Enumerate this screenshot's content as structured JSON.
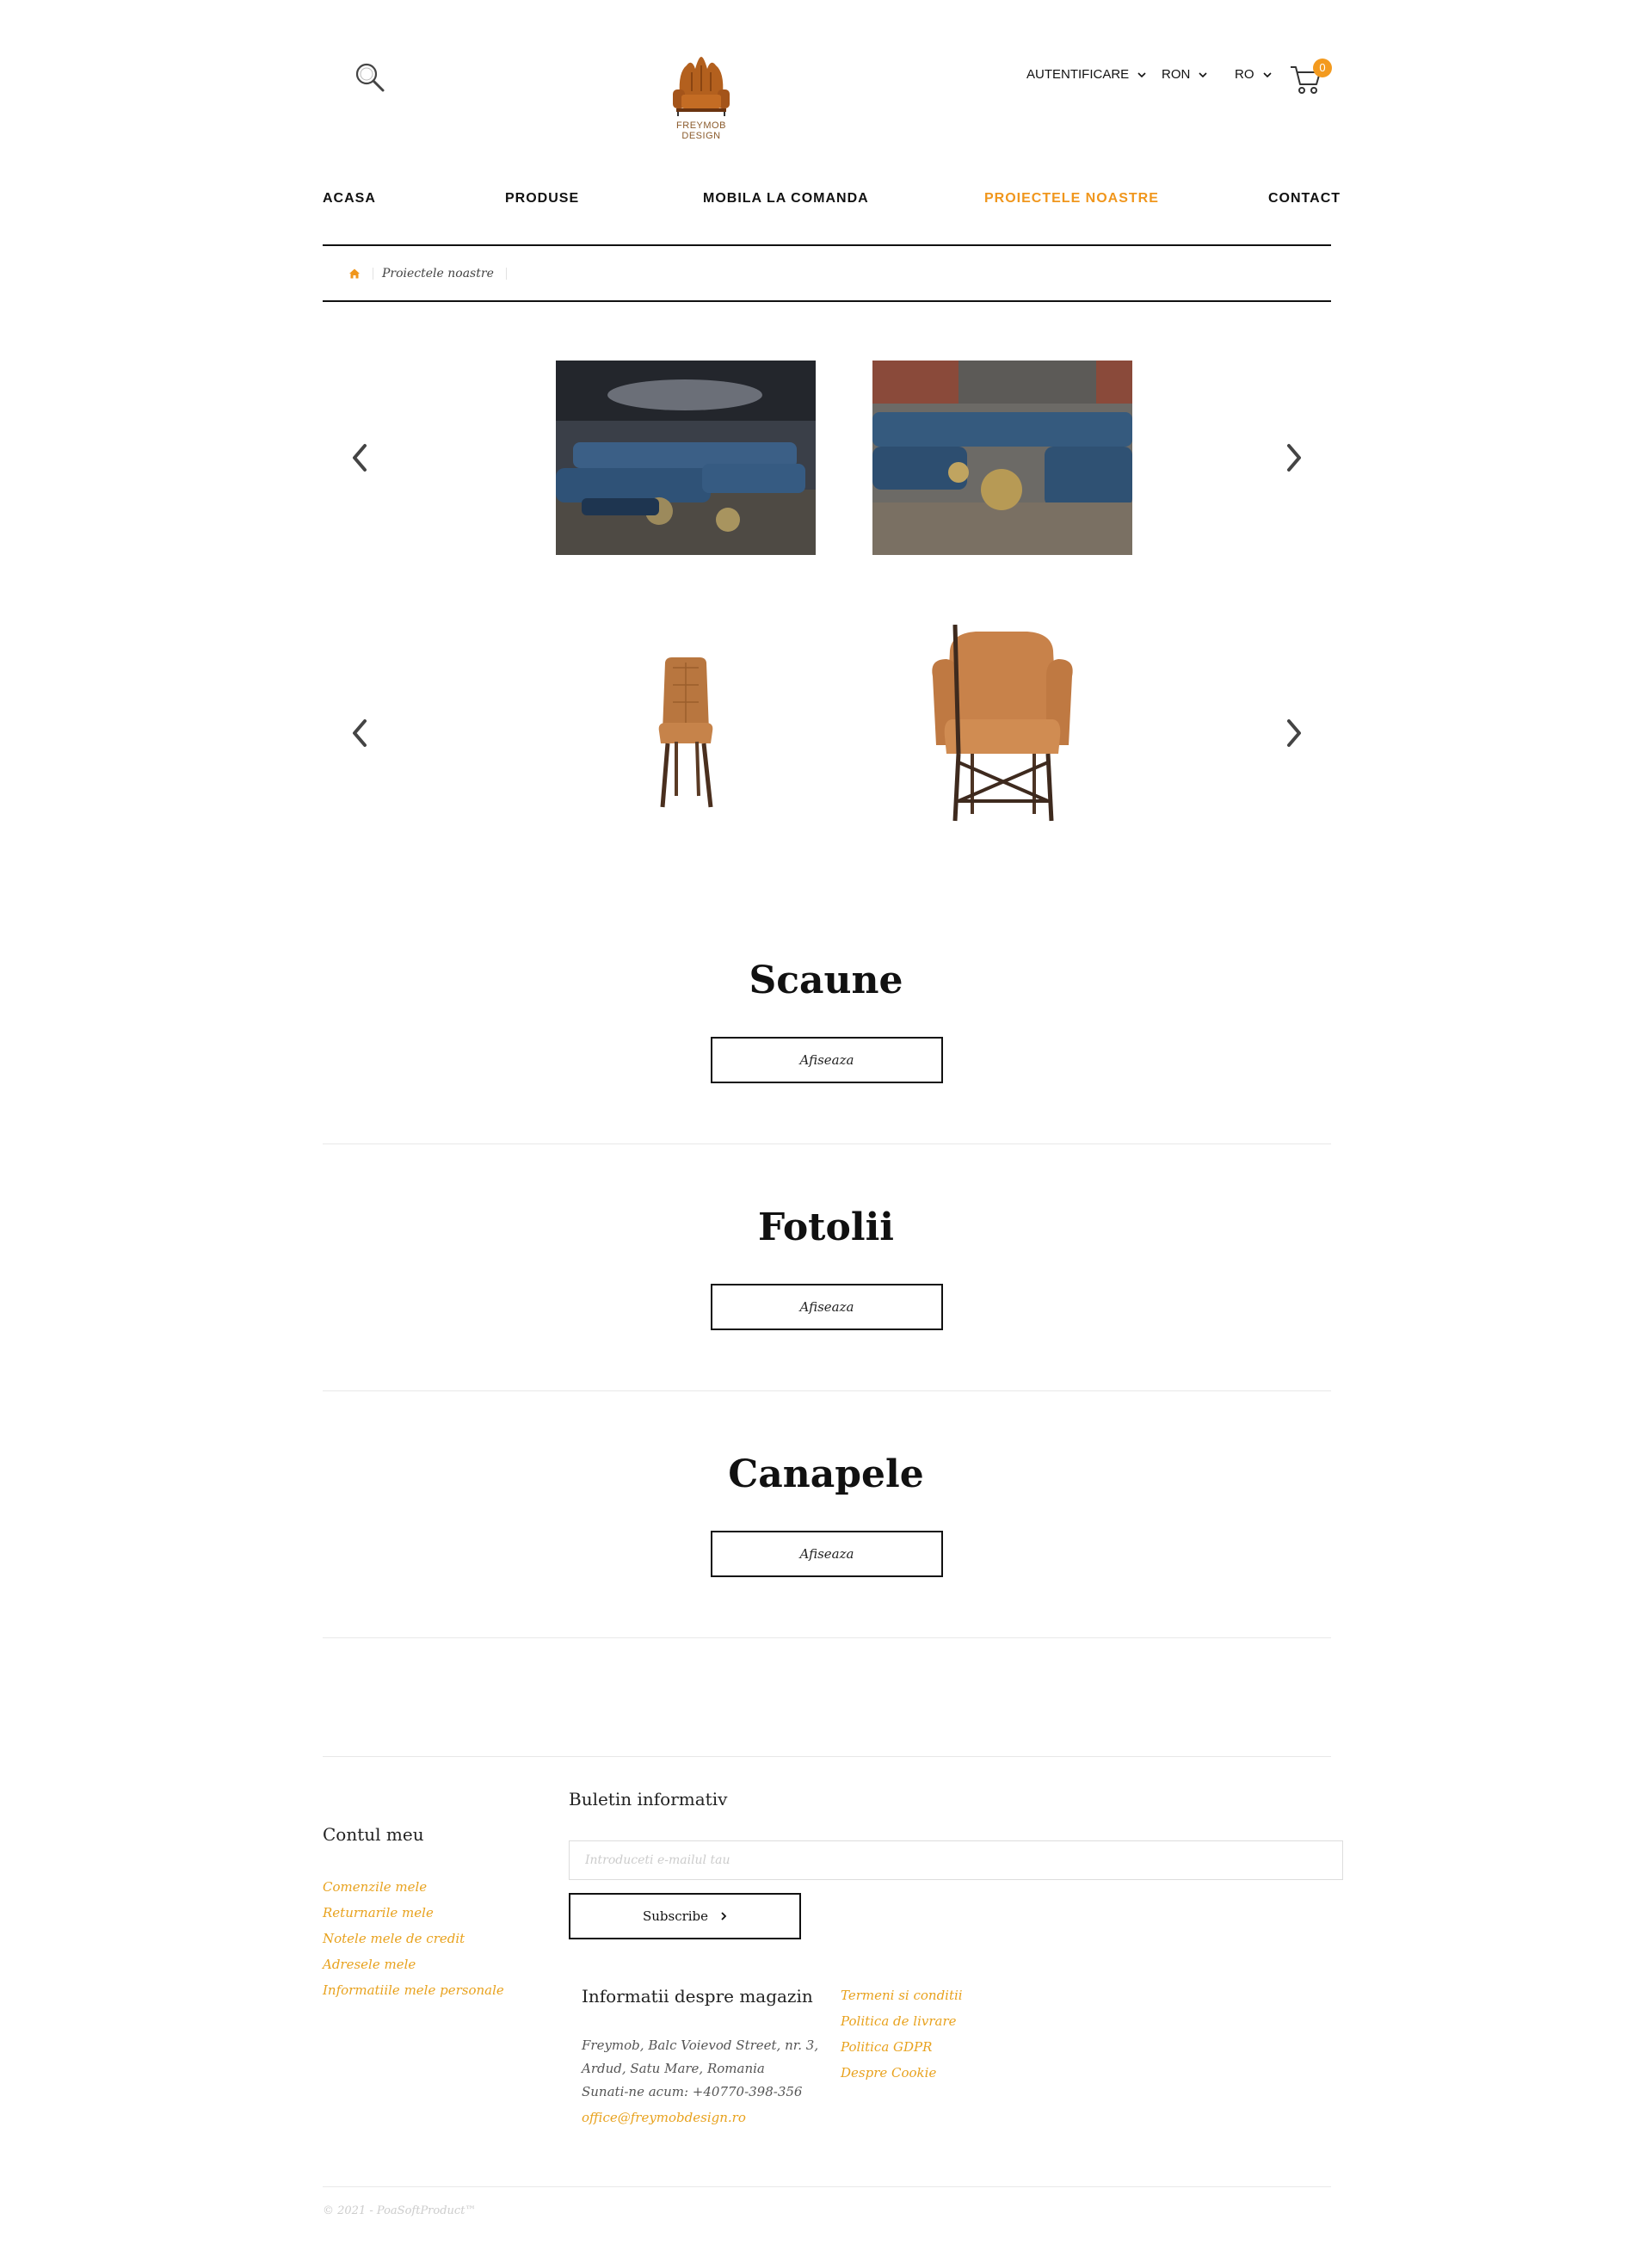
{
  "header": {
    "logo_text_line1": "FREYMOB",
    "logo_text_line2": "DESIGN",
    "account_label": "AUTENTIFICARE",
    "currency_label": "RON",
    "language_label": "RO",
    "cart_count": "0",
    "icons": {
      "search": "search-icon",
      "cart": "cart-icon",
      "dropdown": "chevron-down-icon"
    }
  },
  "nav": {
    "items": [
      {
        "label": "ACASA"
      },
      {
        "label": "PRODUSE"
      },
      {
        "label": "MOBILA LA COMANDA"
      },
      {
        "label": "PROIECTELE NOASTRE"
      },
      {
        "label": "CONTACT"
      }
    ],
    "active_color": "#f0961c"
  },
  "breadcrumb": {
    "current": "Proiectele noastre",
    "home_icon": "home-icon"
  },
  "carousels": [
    {
      "slides": [
        "lounge-photo-1",
        "lounge-photo-2"
      ],
      "prev_icon": "chevron-left-icon",
      "next_icon": "chevron-right-icon"
    },
    {
      "slides": [
        "chair-photo",
        "armchair-photo"
      ],
      "prev_icon": "chevron-left-icon",
      "next_icon": "chevron-right-icon"
    }
  ],
  "categories": [
    {
      "title": "Scaune",
      "button": "Afiseaza"
    },
    {
      "title": "Fotolii",
      "button": "Afiseaza"
    },
    {
      "title": "Canapele",
      "button": "Afiseaza"
    }
  ],
  "footer": {
    "account": {
      "title": "Contul meu",
      "links": [
        "Comenzile mele",
        "Returnarile mele",
        "Notele mele de credit",
        "Adresele mele",
        "Informatiile mele personale"
      ]
    },
    "newsletter": {
      "title": "Buletin informativ",
      "placeholder": "Introduceti e-mailul tau",
      "button": "Subscribe"
    },
    "store_info": {
      "title": "Informatii despre magazin",
      "address_line1": "Freymob, Balc Voievod Street, nr. 3,",
      "address_line2": "Ardud, Satu Mare, Romania",
      "phone": "Sunati-ne acum: +40770-398-356",
      "email": "office@freymobdesign.ro"
    },
    "legal_links": [
      "Termeni si conditii",
      "Politica de livrare",
      "Politica GDPR",
      "Despre Cookie"
    ],
    "copyright": "© 2021 - PoaSoftProduct™"
  },
  "colors": {
    "accent": "#f0961c",
    "link": "#e8a21e",
    "text": "#111111"
  }
}
